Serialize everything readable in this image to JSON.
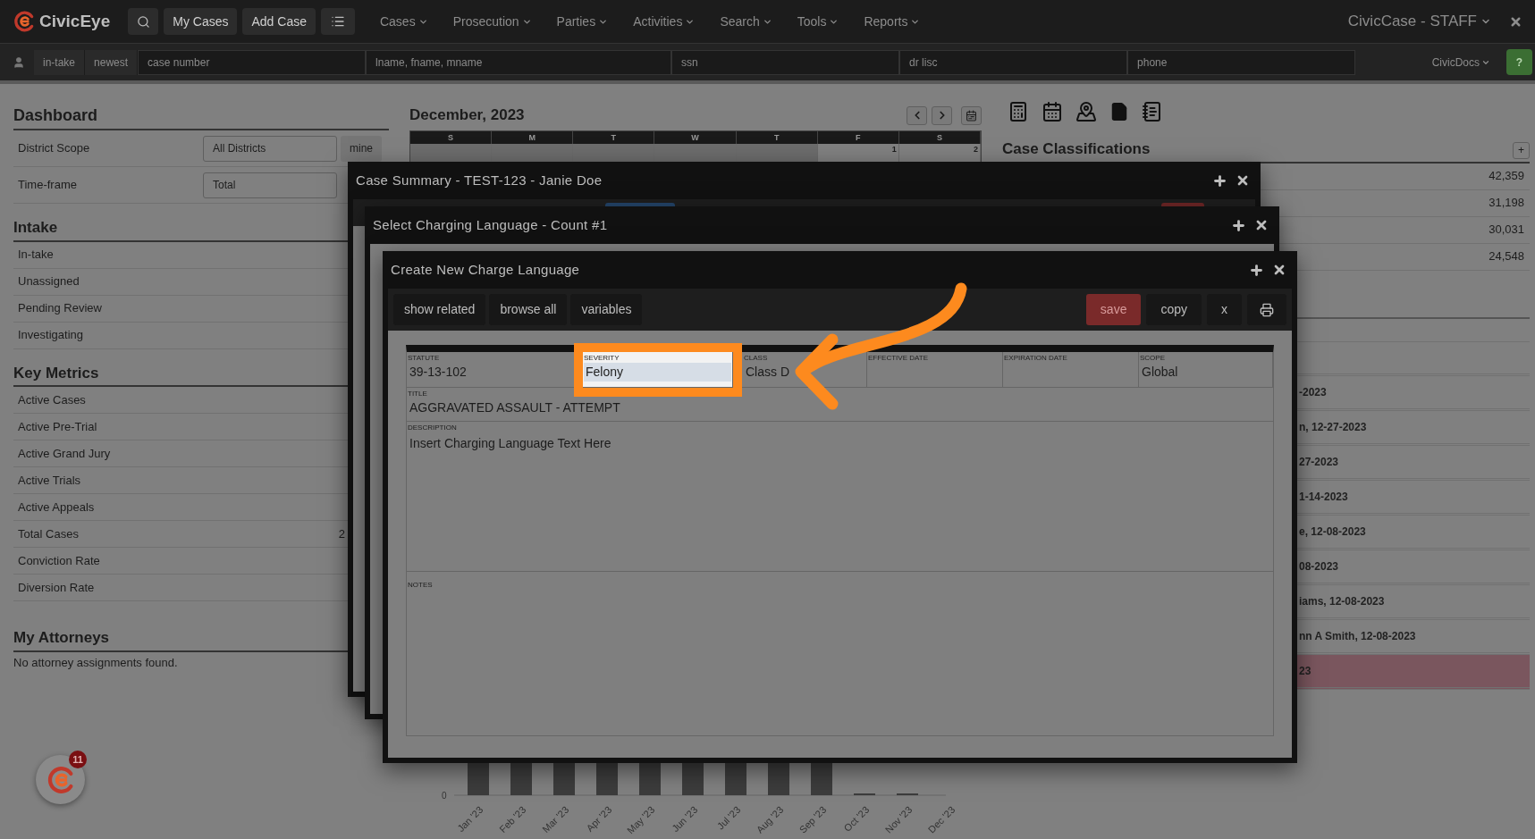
{
  "nav": {
    "brand": "CivicEye",
    "buttons": [
      "My Cases",
      "Add Case"
    ],
    "menus": [
      "Cases",
      "Prosecution",
      "Parties",
      "Activities",
      "Search",
      "Tools",
      "Reports"
    ],
    "account": "CivicCase - STAFF"
  },
  "quick_search": {
    "tabs": [
      "in-take",
      "newest"
    ],
    "fields": [
      {
        "placeholder": "case number"
      },
      {
        "placeholder": "lname, fname, mname"
      },
      {
        "placeholder": "ssn"
      },
      {
        "placeholder": "dr lisc"
      },
      {
        "placeholder": "phone"
      }
    ],
    "docs": "CivicDocs",
    "help": "?"
  },
  "dashboard": {
    "title": "Dashboard",
    "filters": [
      {
        "label": "District Scope",
        "value": "All Districts",
        "button": "mine"
      },
      {
        "label": "Time-frame",
        "value": "Total"
      }
    ],
    "sections": [
      {
        "title": "Intake",
        "rows": [
          {
            "label": "In-take"
          },
          {
            "label": "Unassigned"
          },
          {
            "label": "Pending Review"
          },
          {
            "label": "Investigating"
          }
        ]
      },
      {
        "title": "Key Metrics",
        "rows": [
          {
            "label": "Active Cases"
          },
          {
            "label": "Active Pre-Trial"
          },
          {
            "label": "Active Grand Jury"
          },
          {
            "label": "Active Trials"
          },
          {
            "label": "Active Appeals"
          },
          {
            "label": "Total Cases",
            "value": "2"
          },
          {
            "label": "Conviction Rate"
          },
          {
            "label": "Diversion Rate"
          }
        ]
      }
    ],
    "attorneys": {
      "title": "My Attorneys",
      "empty": "No attorney assignments found."
    }
  },
  "calendar": {
    "title": "December, 2023",
    "weekdays": [
      "S",
      "M",
      "T",
      "W",
      "T",
      "F",
      "S"
    ],
    "days": [
      {
        "in_month": false
      },
      {
        "in_month": false
      },
      {
        "in_month": false
      },
      {
        "in_month": false
      },
      {
        "in_month": false
      },
      {
        "in_month": true,
        "day": "1"
      },
      {
        "in_month": true,
        "day": "2"
      }
    ]
  },
  "classifications": {
    "title": "Case Classifications",
    "add": "+",
    "counts": [
      "42,359",
      "31,198",
      "30,031",
      "24,548"
    ]
  },
  "recent": [
    {
      "text": "-2023",
      "highlighted": false
    },
    {
      "text": "n, 12-27-2023",
      "highlighted": false
    },
    {
      "text": "27-2023",
      "highlighted": false
    },
    {
      "text": "1-14-2023",
      "highlighted": false
    },
    {
      "text": "e, 12-08-2023",
      "highlighted": false
    },
    {
      "text": "08-2023",
      "highlighted": false
    },
    {
      "text": "iams, 12-08-2023",
      "highlighted": false
    },
    {
      "text": "nn A Smith, 12-08-2023",
      "highlighted": false
    },
    {
      "text": "23",
      "highlighted": true
    }
  ],
  "chart": {
    "y_tick": "0",
    "months": [
      "Jan '23",
      "Feb '23",
      "Mar '23",
      "Apr '23",
      "May '23",
      "Jun '23",
      "Jul '23",
      "Aug '23",
      "Sep '23",
      "Oct '23",
      "Nov '23",
      "Dec '23"
    ]
  },
  "windows": [
    {
      "title": "Case Summary - TEST-123 - Janie Doe"
    },
    {
      "title": "Select Charging Language - Count #1"
    },
    {
      "title": "Create New Charge Language"
    }
  ],
  "charge_form": {
    "toolbar": [
      "show related",
      "browse all",
      "variables"
    ],
    "actions": [
      {
        "label": "save",
        "kind": "danger"
      },
      {
        "label": "copy",
        "kind": "plain"
      },
      {
        "label": "x",
        "kind": "plain"
      }
    ],
    "fields": [
      {
        "label": "STATUTE",
        "value": "39-13-102",
        "highlighted": false
      },
      {
        "label": "SEVERITY",
        "value": "Felony",
        "highlighted": true
      },
      {
        "label": "CLASS",
        "value": "Class D",
        "highlighted": false
      },
      {
        "label": "EFFECTIVE DATE",
        "highlighted": false
      },
      {
        "label": "EXPIRATION DATE",
        "highlighted": false
      },
      {
        "label": "SCOPE",
        "value": "Global",
        "highlighted": false
      }
    ],
    "title_field": {
      "label": "TITLE",
      "value": "AGGRAVATED ASSAULT - ATTEMPT"
    },
    "description": {
      "label": "DESCRIPTION",
      "value": "Insert Charging Language Text Here"
    },
    "notes": {
      "label": "NOTES"
    }
  },
  "notification_count": "11"
}
